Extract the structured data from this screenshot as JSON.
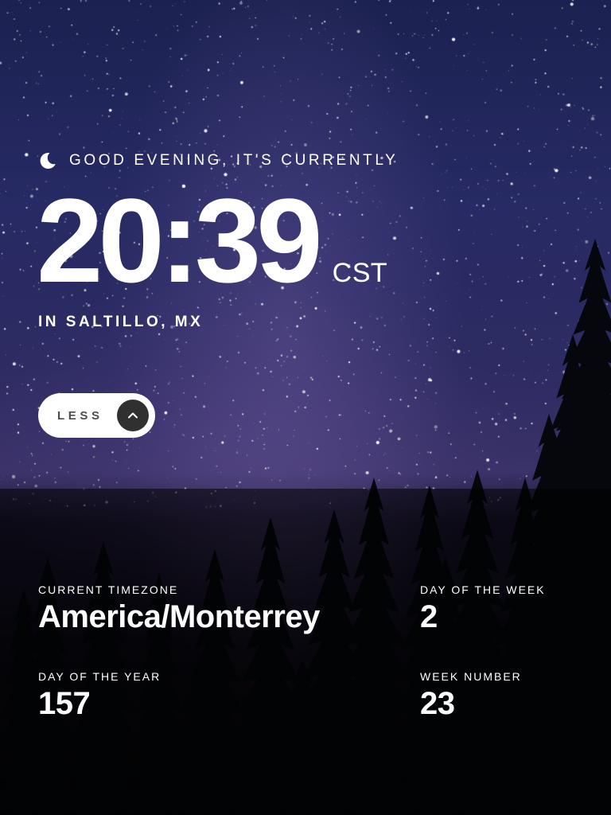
{
  "greeting": {
    "text": "GOOD EVENING, IT'S CURRENTLY",
    "icon": "moon-icon"
  },
  "clock": {
    "time": "20:39",
    "abbreviation": "CST"
  },
  "location": {
    "text": "IN SALTILLO, MX"
  },
  "toggle": {
    "label": "LESS",
    "icon": "chevron-up-icon"
  },
  "details": {
    "timezone": {
      "label": "CURRENT TIMEZONE",
      "value": "America/Monterrey"
    },
    "day_of_week": {
      "label": "DAY OF THE WEEK",
      "value": "2"
    },
    "day_of_year": {
      "label": "DAY OF THE YEAR",
      "value": "157"
    },
    "week_number": {
      "label": "WEEK NUMBER",
      "value": "23"
    }
  },
  "colors": {
    "text": "#ffffff",
    "toggle_bg": "#ffffff",
    "toggle_text": "#4d4d4d",
    "toggle_button": "#303030"
  }
}
